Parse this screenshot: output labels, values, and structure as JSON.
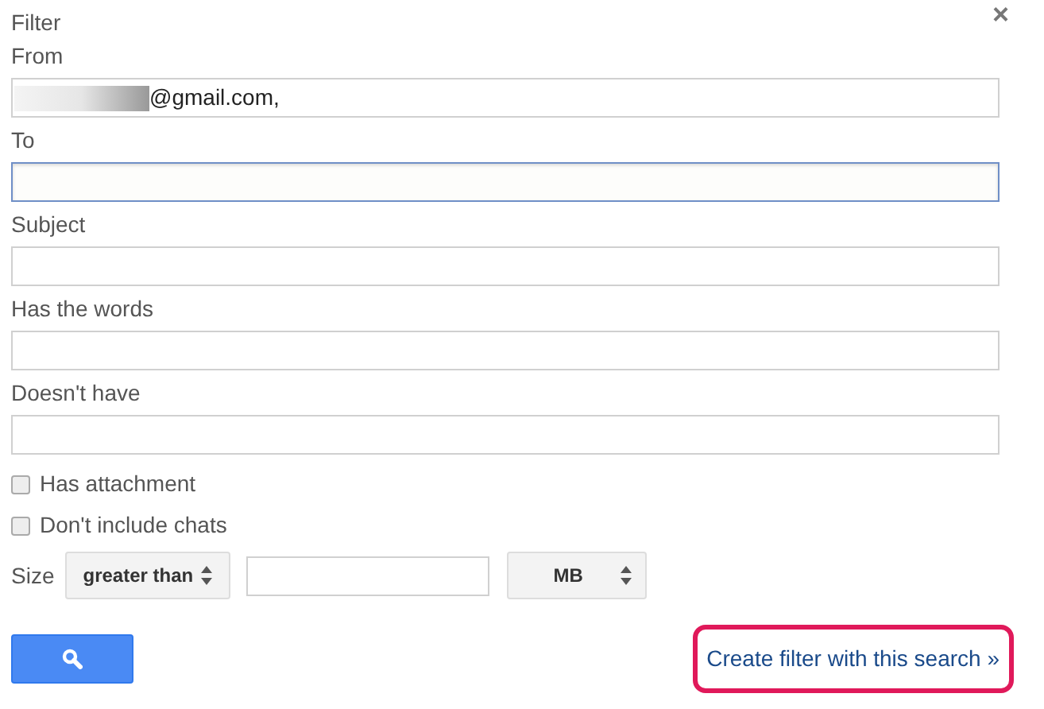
{
  "title": "Filter",
  "close": "×",
  "fields": [
    {
      "label": "From",
      "value": "@gmail.com,",
      "redacted": true,
      "focused": false
    },
    {
      "label": "To",
      "focused": true
    },
    {
      "label": "Subject",
      "focused": false
    },
    {
      "label": "Has the words",
      "focused": false
    },
    {
      "label": "Doesn't have",
      "focused": false
    }
  ],
  "checkboxes": [
    {
      "label": "Has attachment",
      "checked": false
    },
    {
      "label": "Don't include chats",
      "checked": false
    }
  ],
  "size": {
    "label": "Size",
    "operator": "greater than",
    "unit": "MB"
  },
  "link": {
    "label": "Create filter with this search »",
    "highlighted": true
  }
}
